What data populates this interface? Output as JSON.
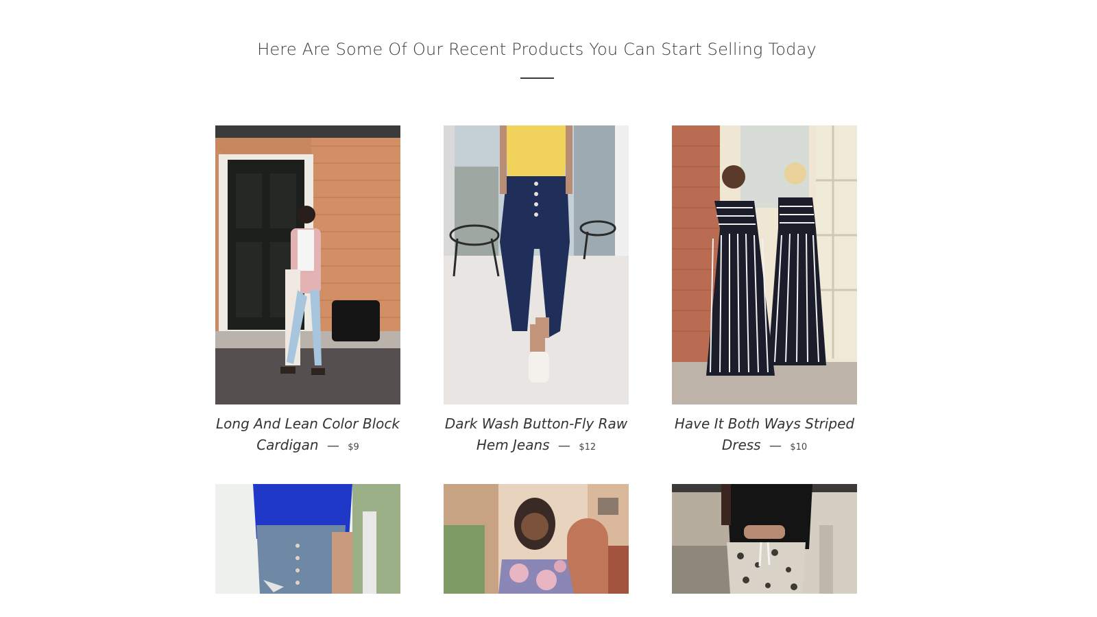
{
  "section": {
    "title": "Here Are Some Of Our Recent Products You Can Start Selling Today"
  },
  "products": [
    {
      "name": "Long And Lean Color Block Cardigan",
      "separator": "—",
      "price": "$9",
      "image_icon": "product-photo-icon"
    },
    {
      "name": "Dark Wash Button-Fly Raw Hem Jeans",
      "separator": "—",
      "price": "$12",
      "image_icon": "product-photo-icon"
    },
    {
      "name": "Have It Both Ways Striped Dress",
      "separator": "—",
      "price": "$10",
      "image_icon": "product-photo-icon"
    },
    {
      "name": "",
      "separator": "",
      "price": "",
      "image_icon": "product-photo-icon"
    },
    {
      "name": "",
      "separator": "",
      "price": "",
      "image_icon": "product-photo-icon"
    },
    {
      "name": "",
      "separator": "",
      "price": "",
      "image_icon": "product-photo-icon"
    }
  ],
  "colors": {
    "text": "#333333",
    "background": "#ffffff"
  }
}
